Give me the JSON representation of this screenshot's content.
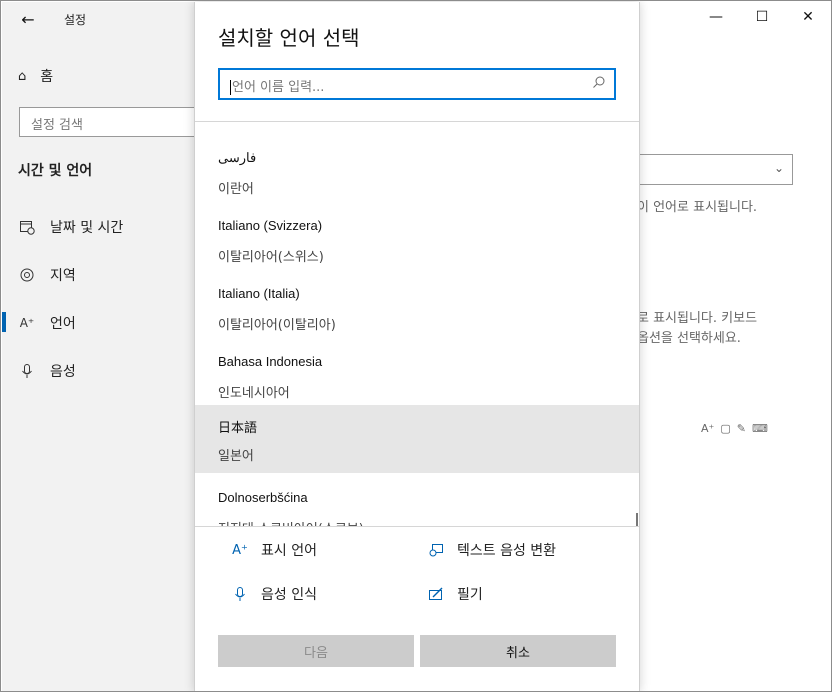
{
  "settings": {
    "app_title": "설정",
    "home_label": "홈",
    "search_placeholder": "설정 검색",
    "section_title": "시간 및 언어",
    "nav": [
      {
        "label": "날짜 및 시간",
        "icon": "calendar-clock-icon"
      },
      {
        "label": "지역",
        "icon": "globe-icon"
      },
      {
        "label": "언어",
        "icon": "language-icon"
      },
      {
        "label": "음성",
        "icon": "microphone-icon"
      }
    ],
    "active_nav": "언어",
    "background_text_1": "이 언어로 표시됩니다.",
    "background_text_2_line1": "로 표시됩니다. 키보드",
    "background_text_2_line2": "옵션을 선택하세요."
  },
  "window_controls": {
    "minimize": "—",
    "maximize": "☐",
    "close": "✕"
  },
  "dialog": {
    "title": "설치할 언어 선택",
    "search_placeholder": "언어 이름 입력...",
    "languages": [
      {
        "native": "فارسی",
        "korean": "이란어",
        "selected": false
      },
      {
        "native": "Italiano (Svizzera)",
        "korean": "이탈리아어(스위스)",
        "selected": false
      },
      {
        "native": "Italiano (Italia)",
        "korean": "이탈리아어(이탈리아)",
        "selected": false
      },
      {
        "native": "Bahasa Indonesia",
        "korean": "인도네시아어",
        "selected": false
      },
      {
        "native": "日本語",
        "korean": "일본어",
        "selected": true
      },
      {
        "native": "Dolnoserbšćina",
        "korean": "저지대 소르비아어(소르브)",
        "selected": false
      }
    ],
    "features": {
      "display_language": "표시 언어",
      "text_to_speech": "텍스트 음성 변환",
      "speech_recognition": "음성 인식",
      "handwriting": "필기"
    },
    "buttons": {
      "next": "다음",
      "cancel": "취소"
    }
  },
  "colors": {
    "accent": "#0078d7",
    "sidebar_bg": "#f2f2f2",
    "selected_item_bg": "#e6e6e6",
    "button_bg": "#cccccc"
  }
}
